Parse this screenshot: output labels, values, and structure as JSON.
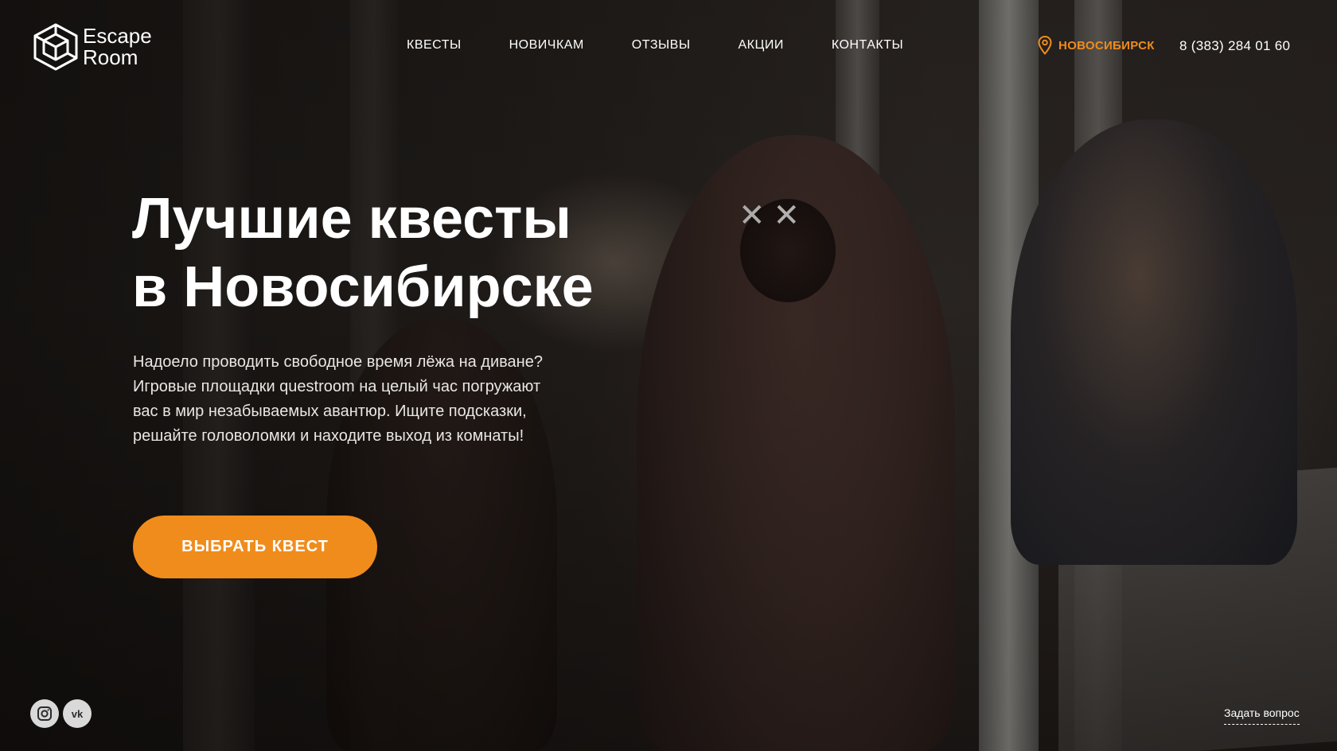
{
  "logo": {
    "line1": "Escape",
    "line2": "Room"
  },
  "nav": {
    "items": [
      {
        "label": "КВЕСТЫ"
      },
      {
        "label": "НОВИЧКАМ"
      },
      {
        "label": "ОТЗЫВЫ"
      },
      {
        "label": "АКЦИИ"
      },
      {
        "label": "КОНТАКТЫ"
      }
    ]
  },
  "header": {
    "city": "НОВОСИБИРСК",
    "phone": "8 (383) 284 01 60"
  },
  "hero": {
    "title_line1": "Лучшие квесты",
    "title_line2": "в Новосибирске",
    "text_lines": [
      "Надоело проводить свободное время лёжа на диване?",
      "Игровые площадки questroom на целый час погружают",
      "вас  в мир незабываемых авантюр. Ищите подсказки,",
      "решайте головоломки и находите выход из комнаты!"
    ],
    "cta_label": "ВЫБРАТЬ КВЕСТ"
  },
  "footer": {
    "socials": [
      {
        "icon": "instagram-icon"
      },
      {
        "icon": "vk-icon",
        "text": "vk"
      }
    ],
    "ask_label": "Задать вопрос"
  },
  "colors": {
    "accent": "#f08c1c",
    "text": "#ffffff",
    "social_bg": "#d9d9d9"
  }
}
